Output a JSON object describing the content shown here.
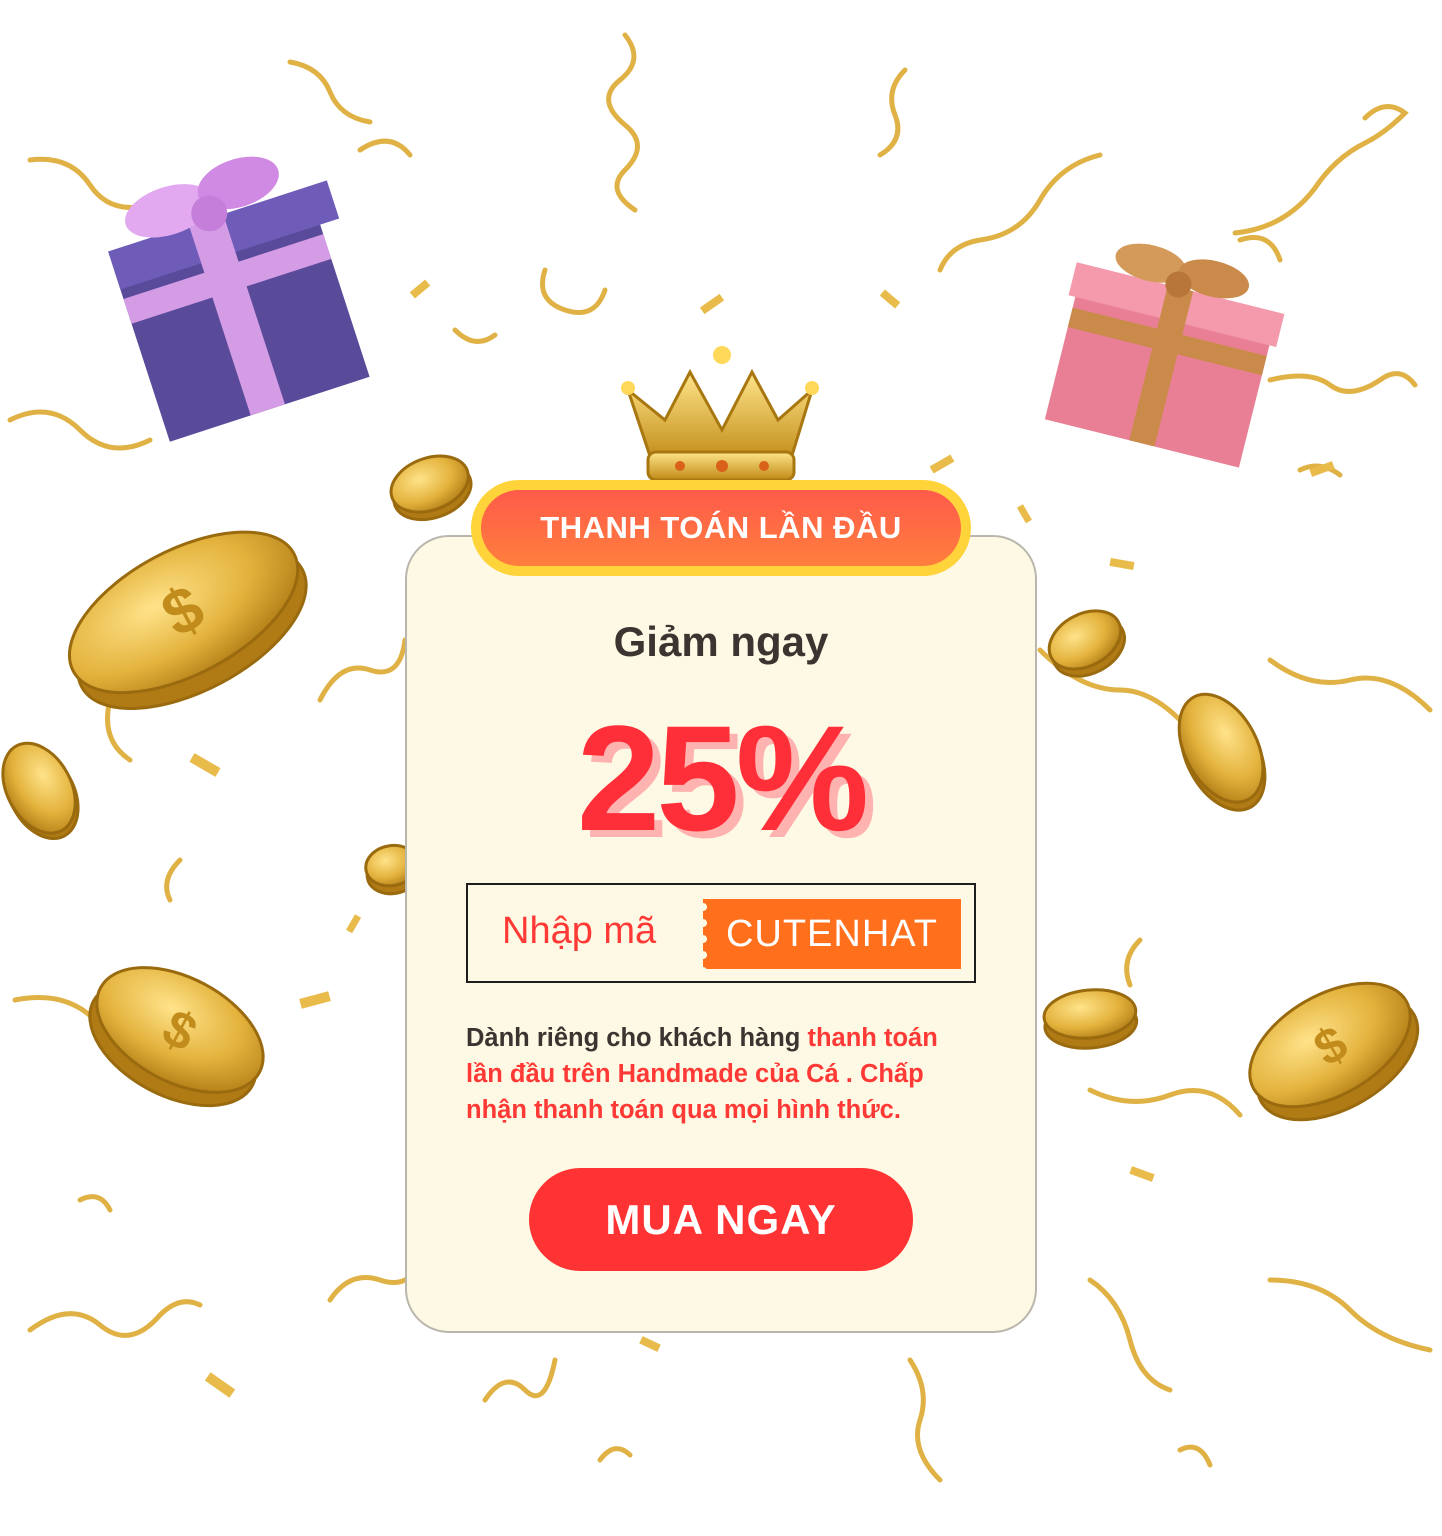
{
  "promo": {
    "header": "THANH TOÁN LẦN ĐẦU",
    "subtitle": "Giảm ngay",
    "discount": "25%",
    "code_label": "Nhập mã",
    "code": "CUTENHAT",
    "description": {
      "part1": "Dành riêng cho khách hàng ",
      "part2": "thanh toán lần đầu trên ",
      "part3": "Handmade của Cá",
      "part4": " . Chấp nhận thanh toán qua mọi hình thức."
    },
    "cta": "MUA NGAY"
  },
  "colors": {
    "accent": "#ff3333",
    "code_tag": "#ff6f1c",
    "header_border": "#ffd43a",
    "card_bg": "#fef9e4",
    "gold": "#e3b23c"
  },
  "icons": [
    "crown-icon",
    "gift-box-purple-icon",
    "gift-box-pink-icon",
    "gold-coin-icon",
    "confetti-ribbon"
  ]
}
